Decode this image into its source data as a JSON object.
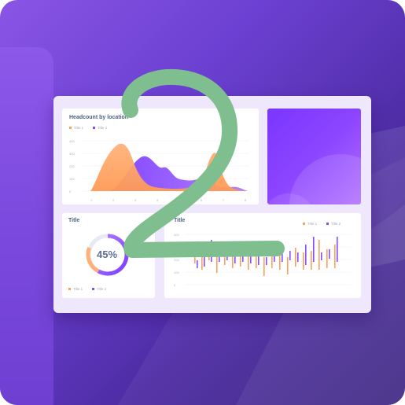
{
  "colors": {
    "background": "#6a3fd0",
    "card": "#efe7fb",
    "orange": "#ffa05a",
    "purple": "#8a4cff",
    "overlay_green": "#7fbf8f"
  },
  "overlay_digit": "2",
  "headcount_panel": {
    "title": "Headcount by location",
    "legend": [
      {
        "label": "Title 1",
        "color": "#ffa05a"
      },
      {
        "label": "Title 2",
        "color": "#8a4cff"
      }
    ],
    "y_ticks": [
      "400",
      "300",
      "200",
      "100",
      "0"
    ],
    "x_ticks": [
      "1",
      "2",
      "3",
      "4",
      "5",
      "6",
      "7",
      "8"
    ]
  },
  "donut_panel": {
    "title": "Title",
    "value_label": "45%",
    "legend": [
      {
        "label": "Title 1",
        "color": "#ffa05a"
      },
      {
        "label": "Title 2",
        "color": "#8a4cff"
      }
    ]
  },
  "bars_panel": {
    "title": "Title",
    "legend": [
      {
        "label": "Title 1",
        "color": "#ffa05a"
      },
      {
        "label": "Title 2",
        "color": "#8a4cff"
      }
    ],
    "y_ticks": [
      "400",
      "300",
      "200",
      "100",
      "0"
    ]
  }
}
